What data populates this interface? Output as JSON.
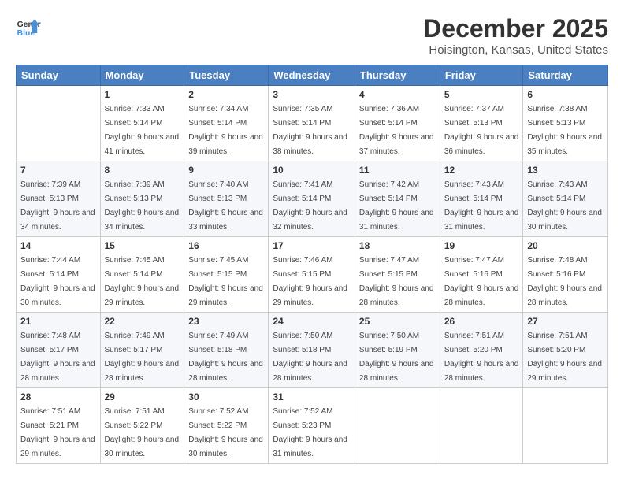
{
  "logo": {
    "line1": "General",
    "line2": "Blue"
  },
  "title": "December 2025",
  "location": "Hoisington, Kansas, United States",
  "days_of_week": [
    "Sunday",
    "Monday",
    "Tuesday",
    "Wednesday",
    "Thursday",
    "Friday",
    "Saturday"
  ],
  "weeks": [
    [
      {
        "day": "",
        "sunrise": "",
        "sunset": "",
        "daylight": ""
      },
      {
        "day": "1",
        "sunrise": "Sunrise: 7:33 AM",
        "sunset": "Sunset: 5:14 PM",
        "daylight": "Daylight: 9 hours and 41 minutes."
      },
      {
        "day": "2",
        "sunrise": "Sunrise: 7:34 AM",
        "sunset": "Sunset: 5:14 PM",
        "daylight": "Daylight: 9 hours and 39 minutes."
      },
      {
        "day": "3",
        "sunrise": "Sunrise: 7:35 AM",
        "sunset": "Sunset: 5:14 PM",
        "daylight": "Daylight: 9 hours and 38 minutes."
      },
      {
        "day": "4",
        "sunrise": "Sunrise: 7:36 AM",
        "sunset": "Sunset: 5:14 PM",
        "daylight": "Daylight: 9 hours and 37 minutes."
      },
      {
        "day": "5",
        "sunrise": "Sunrise: 7:37 AM",
        "sunset": "Sunset: 5:13 PM",
        "daylight": "Daylight: 9 hours and 36 minutes."
      },
      {
        "day": "6",
        "sunrise": "Sunrise: 7:38 AM",
        "sunset": "Sunset: 5:13 PM",
        "daylight": "Daylight: 9 hours and 35 minutes."
      }
    ],
    [
      {
        "day": "7",
        "sunrise": "Sunrise: 7:39 AM",
        "sunset": "Sunset: 5:13 PM",
        "daylight": "Daylight: 9 hours and 34 minutes."
      },
      {
        "day": "8",
        "sunrise": "Sunrise: 7:39 AM",
        "sunset": "Sunset: 5:13 PM",
        "daylight": "Daylight: 9 hours and 34 minutes."
      },
      {
        "day": "9",
        "sunrise": "Sunrise: 7:40 AM",
        "sunset": "Sunset: 5:13 PM",
        "daylight": "Daylight: 9 hours and 33 minutes."
      },
      {
        "day": "10",
        "sunrise": "Sunrise: 7:41 AM",
        "sunset": "Sunset: 5:14 PM",
        "daylight": "Daylight: 9 hours and 32 minutes."
      },
      {
        "day": "11",
        "sunrise": "Sunrise: 7:42 AM",
        "sunset": "Sunset: 5:14 PM",
        "daylight": "Daylight: 9 hours and 31 minutes."
      },
      {
        "day": "12",
        "sunrise": "Sunrise: 7:43 AM",
        "sunset": "Sunset: 5:14 PM",
        "daylight": "Daylight: 9 hours and 31 minutes."
      },
      {
        "day": "13",
        "sunrise": "Sunrise: 7:43 AM",
        "sunset": "Sunset: 5:14 PM",
        "daylight": "Daylight: 9 hours and 30 minutes."
      }
    ],
    [
      {
        "day": "14",
        "sunrise": "Sunrise: 7:44 AM",
        "sunset": "Sunset: 5:14 PM",
        "daylight": "Daylight: 9 hours and 30 minutes."
      },
      {
        "day": "15",
        "sunrise": "Sunrise: 7:45 AM",
        "sunset": "Sunset: 5:14 PM",
        "daylight": "Daylight: 9 hours and 29 minutes."
      },
      {
        "day": "16",
        "sunrise": "Sunrise: 7:45 AM",
        "sunset": "Sunset: 5:15 PM",
        "daylight": "Daylight: 9 hours and 29 minutes."
      },
      {
        "day": "17",
        "sunrise": "Sunrise: 7:46 AM",
        "sunset": "Sunset: 5:15 PM",
        "daylight": "Daylight: 9 hours and 29 minutes."
      },
      {
        "day": "18",
        "sunrise": "Sunrise: 7:47 AM",
        "sunset": "Sunset: 5:15 PM",
        "daylight": "Daylight: 9 hours and 28 minutes."
      },
      {
        "day": "19",
        "sunrise": "Sunrise: 7:47 AM",
        "sunset": "Sunset: 5:16 PM",
        "daylight": "Daylight: 9 hours and 28 minutes."
      },
      {
        "day": "20",
        "sunrise": "Sunrise: 7:48 AM",
        "sunset": "Sunset: 5:16 PM",
        "daylight": "Daylight: 9 hours and 28 minutes."
      }
    ],
    [
      {
        "day": "21",
        "sunrise": "Sunrise: 7:48 AM",
        "sunset": "Sunset: 5:17 PM",
        "daylight": "Daylight: 9 hours and 28 minutes."
      },
      {
        "day": "22",
        "sunrise": "Sunrise: 7:49 AM",
        "sunset": "Sunset: 5:17 PM",
        "daylight": "Daylight: 9 hours and 28 minutes."
      },
      {
        "day": "23",
        "sunrise": "Sunrise: 7:49 AM",
        "sunset": "Sunset: 5:18 PM",
        "daylight": "Daylight: 9 hours and 28 minutes."
      },
      {
        "day": "24",
        "sunrise": "Sunrise: 7:50 AM",
        "sunset": "Sunset: 5:18 PM",
        "daylight": "Daylight: 9 hours and 28 minutes."
      },
      {
        "day": "25",
        "sunrise": "Sunrise: 7:50 AM",
        "sunset": "Sunset: 5:19 PM",
        "daylight": "Daylight: 9 hours and 28 minutes."
      },
      {
        "day": "26",
        "sunrise": "Sunrise: 7:51 AM",
        "sunset": "Sunset: 5:20 PM",
        "daylight": "Daylight: 9 hours and 28 minutes."
      },
      {
        "day": "27",
        "sunrise": "Sunrise: 7:51 AM",
        "sunset": "Sunset: 5:20 PM",
        "daylight": "Daylight: 9 hours and 29 minutes."
      }
    ],
    [
      {
        "day": "28",
        "sunrise": "Sunrise: 7:51 AM",
        "sunset": "Sunset: 5:21 PM",
        "daylight": "Daylight: 9 hours and 29 minutes."
      },
      {
        "day": "29",
        "sunrise": "Sunrise: 7:51 AM",
        "sunset": "Sunset: 5:22 PM",
        "daylight": "Daylight: 9 hours and 30 minutes."
      },
      {
        "day": "30",
        "sunrise": "Sunrise: 7:52 AM",
        "sunset": "Sunset: 5:22 PM",
        "daylight": "Daylight: 9 hours and 30 minutes."
      },
      {
        "day": "31",
        "sunrise": "Sunrise: 7:52 AM",
        "sunset": "Sunset: 5:23 PM",
        "daylight": "Daylight: 9 hours and 31 minutes."
      },
      {
        "day": "",
        "sunrise": "",
        "sunset": "",
        "daylight": ""
      },
      {
        "day": "",
        "sunrise": "",
        "sunset": "",
        "daylight": ""
      },
      {
        "day": "",
        "sunrise": "",
        "sunset": "",
        "daylight": ""
      }
    ]
  ]
}
